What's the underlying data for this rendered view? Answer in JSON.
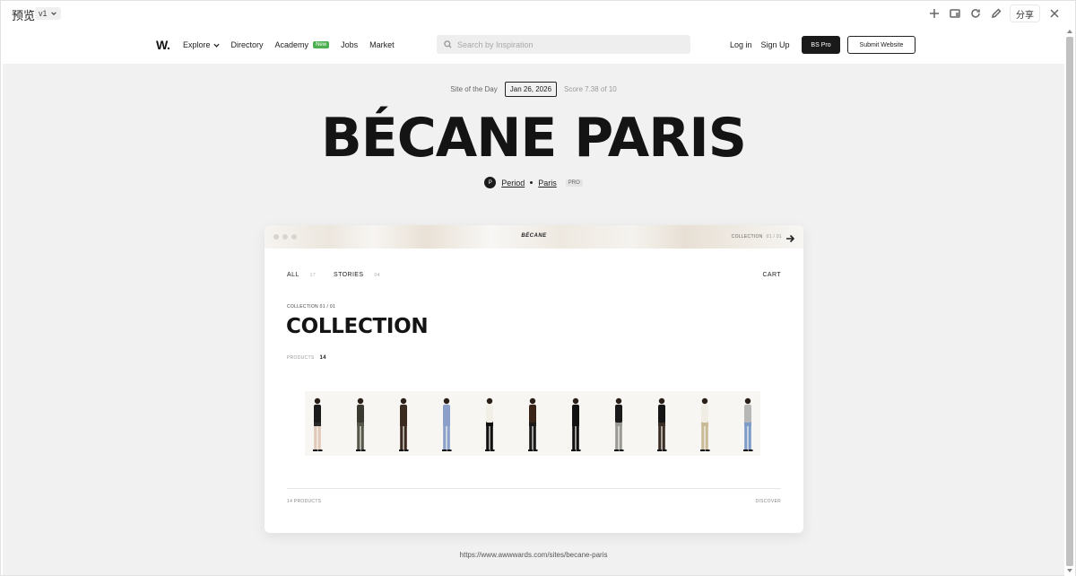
{
  "preview": {
    "title": "预览",
    "version": "v1",
    "share_label": "分享",
    "tool_icons": [
      "add-icon",
      "device-icon",
      "refresh-icon",
      "edit-icon",
      "close-icon"
    ]
  },
  "header": {
    "logo": "W.",
    "nav": {
      "explore": "Explore",
      "directory": "Directory",
      "academy": "Academy",
      "academy_badge": "New",
      "jobs": "Jobs",
      "market": "Market"
    },
    "search_placeholder": "Search by Inspiration",
    "login": "Log in",
    "signup": "Sign Up",
    "pro_button": "BS Pro",
    "submit_button": "Submit Website"
  },
  "hero": {
    "sotd_label": "Site of the Day",
    "date": "Jan 26, 2026",
    "score": "Score 7.38 of 10",
    "title": "BÉCANE PARIS",
    "avatar_letter": "P",
    "author": "Period",
    "location": "Paris",
    "pro_tag": "PRO"
  },
  "card": {
    "logo": "BÉCANE",
    "collection_label": "COLLECTION",
    "collection_num": "01 / 01",
    "tabs": [
      {
        "label": "ALL",
        "count": "17"
      },
      {
        "label": "STORIES",
        "count": "04"
      }
    ],
    "cart": "CART",
    "collection_sub": "COLLECTION 01 / 01",
    "collection_title": "COLLECTION",
    "products_label": "PRODUCTS",
    "products_count": "14",
    "footer_left": "14 PRODUCTS",
    "footer_right": "DISCOVER"
  },
  "models": [
    {
      "top": "#1c1c1c",
      "bottom": "#2a2a2a",
      "legs": "#e0c9b8"
    },
    {
      "top": "#3a3a30",
      "bottom": "#55584a",
      "legs": "#55584a"
    },
    {
      "top": "#3a2a20",
      "bottom": "#3a2a20",
      "legs": "#3a2a20"
    },
    {
      "top": "#8aa0c8",
      "bottom": "#8aa0c8",
      "legs": "#8aa0c8"
    },
    {
      "top": "#f2efe6",
      "bottom": "#111111",
      "legs": "#111111"
    },
    {
      "top": "#3a2418",
      "bottom": "#1a1a1a",
      "legs": "#1a1a1a"
    },
    {
      "top": "#111111",
      "bottom": "#111111",
      "legs": "#111111"
    },
    {
      "top": "#1a1a1a",
      "bottom": "#9a9a94",
      "legs": "#9a9a94"
    },
    {
      "top": "#151515",
      "bottom": "#3a2e26",
      "legs": "#3a2e26"
    },
    {
      "top": "#f0ede4",
      "bottom": "#c9bb97",
      "legs": "#c9bb97"
    },
    {
      "top": "#b7b8b6",
      "bottom": "#7d9cc7",
      "legs": "#7d9cc7"
    }
  ],
  "url": "https://www.awwwards.com/sites/becane-paris"
}
